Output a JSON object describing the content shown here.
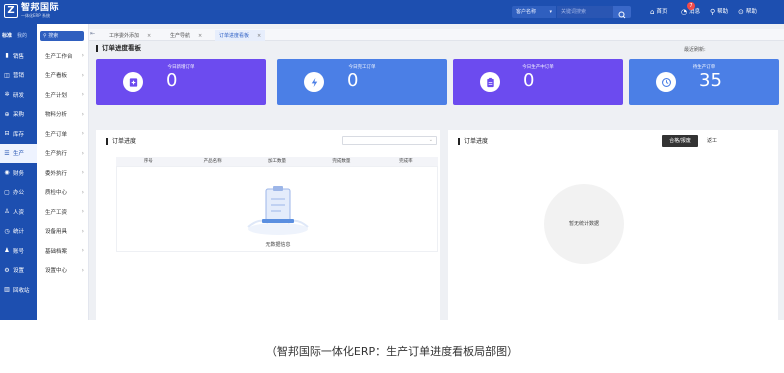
{
  "topbar": {
    "logo_mark": "Z",
    "logo_name": "智邦国际",
    "logo_tag": "一体化ERP 系统",
    "search_select": "客户名称",
    "search_placeholder": "关键词搜索",
    "links": {
      "home": "首页",
      "messages": "消息",
      "messages_badge": "7",
      "help": "帮助",
      "help2": "帮助"
    }
  },
  "sidebar": {
    "tabs": [
      "标准",
      "我的"
    ],
    "items": [
      {
        "icon": "chart-icon",
        "label": "销售"
      },
      {
        "icon": "cart-icon",
        "label": "营销"
      },
      {
        "icon": "gear-icon",
        "label": "研发"
      },
      {
        "icon": "cart-icon",
        "label": "采购"
      },
      {
        "icon": "box-icon",
        "label": "库存"
      },
      {
        "icon": "list-icon",
        "label": "生产"
      },
      {
        "icon": "finance-icon",
        "label": "财务"
      },
      {
        "icon": "briefcase-icon",
        "label": "办公"
      },
      {
        "icon": "people-icon",
        "label": "人资"
      },
      {
        "icon": "clock-icon",
        "label": "统计"
      },
      {
        "icon": "user-icon",
        "label": "账号"
      },
      {
        "icon": "settings-icon",
        "label": "设置"
      },
      {
        "icon": "trash-icon",
        "label": "回收站"
      }
    ]
  },
  "submenu": {
    "search_placeholder": "搜索",
    "items": [
      "生产工作台",
      "生产看板",
      "生产计划",
      "物料分析",
      "生产订单",
      "生产执行",
      "委外执行",
      "质检中心",
      "生产工资",
      "设备用具",
      "基础档案",
      "设置中心"
    ]
  },
  "tabs": [
    {
      "label": "工序委外添加"
    },
    {
      "label": "生产导航"
    },
    {
      "label": "订单进度看板"
    }
  ],
  "page": {
    "title": "订单进度看板",
    "updated_label": "最近刷新:",
    "updated_value": ""
  },
  "stats": [
    {
      "label": "今日新增订单",
      "value": "0",
      "color": "#6c4bef",
      "icon": "plus-doc-icon"
    },
    {
      "label": "今日完工订单",
      "value": "0",
      "color": "#4b7fe6",
      "icon": "lightning-icon"
    },
    {
      "label": "今日生产中订单",
      "value": "0",
      "color": "#6c4bef",
      "icon": "clipboard-icon"
    },
    {
      "label": "待生产订单",
      "value": "35",
      "color": "#4b7fe6",
      "icon": "clock-icon"
    }
  ],
  "left_panel": {
    "title": "订单进度",
    "select_caret": "⌄",
    "columns": [
      "序号",
      "产品名称",
      "加工数量",
      "完成数量",
      "完成率"
    ],
    "empty_text": "无数据信息"
  },
  "right_panel": {
    "title": "订单进度",
    "seg_on": "合格/报废",
    "seg_off": "返工",
    "empty_text": "暂无统计数据"
  },
  "caption": "（智邦国际一体化ERP：生产订单进度看板局部图）"
}
